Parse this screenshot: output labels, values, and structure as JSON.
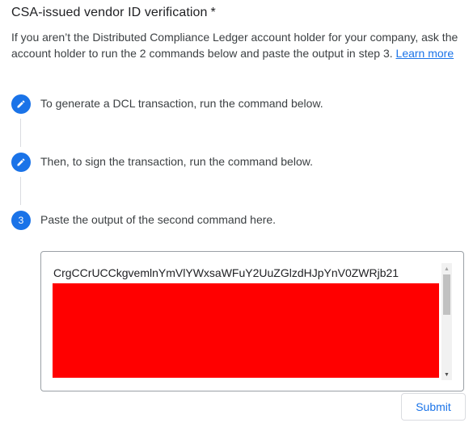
{
  "form": {
    "title": "CSA-issued vendor ID verification",
    "required_marker": "*",
    "description": "If you aren’t the Distributed Compliance Ledger account holder for your company, ask the account holder to run the 2 commands below and paste the output in step 3.",
    "learn_more_label": "Learn more",
    "link_color": "#1a73e8"
  },
  "steps": [
    {
      "icon": "pencil-icon",
      "label": "To generate a DCL transaction, run the command below."
    },
    {
      "icon": "pencil-icon",
      "label": "Then, to sign the transaction, run the command below."
    },
    {
      "number": "3",
      "label": "Paste the output of the second command here."
    }
  ],
  "output_field": {
    "value": "CrgCCrUCCkgvemlnYmVlYWxsaWFuY2UuZGlzdHJpYnV0ZWRjb21",
    "redaction_color": "#ff0000"
  },
  "actions": {
    "submit_label": "Submit"
  },
  "theme": {
    "accent": "#1a73e8"
  }
}
